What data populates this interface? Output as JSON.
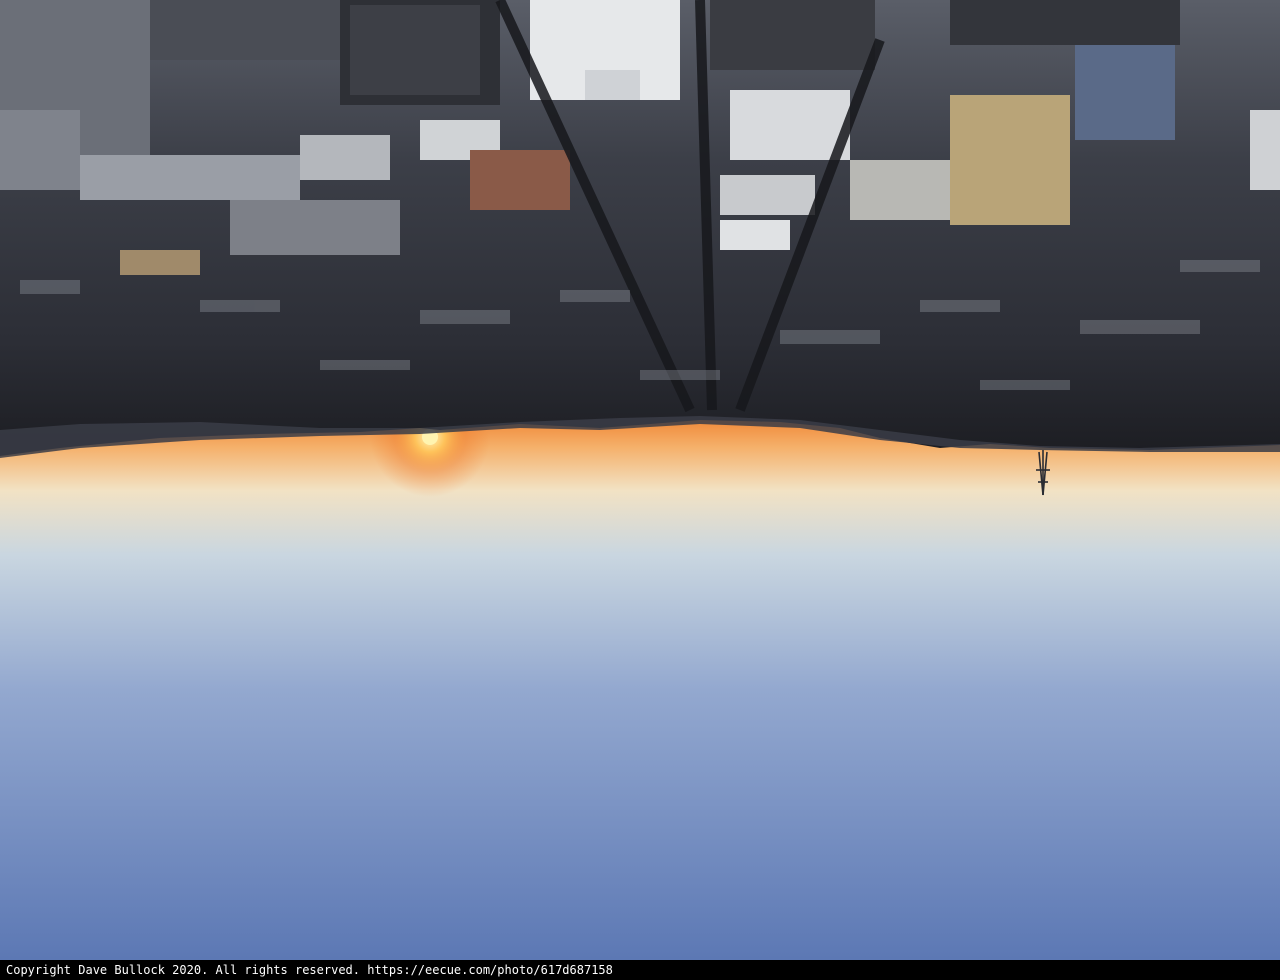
{
  "photo": {
    "subject": "upside-down aerial view of a dense city at sunset with a glowing sun on the horizon and a transmission tower on a hill",
    "orientation": "inverted",
    "colors": {
      "sky_top_near_horizon": "#f08a3a",
      "sky_mid": "#c9d6e0",
      "sky_bottom": "#5c78b4",
      "sun": "#fff2a0",
      "city_dark": "#2a2c33",
      "city_light": "#8c8f98"
    }
  },
  "caption": {
    "text": "Copyright Dave Bullock 2020. All rights reserved. https://eecue.com/photo/617d687158"
  }
}
